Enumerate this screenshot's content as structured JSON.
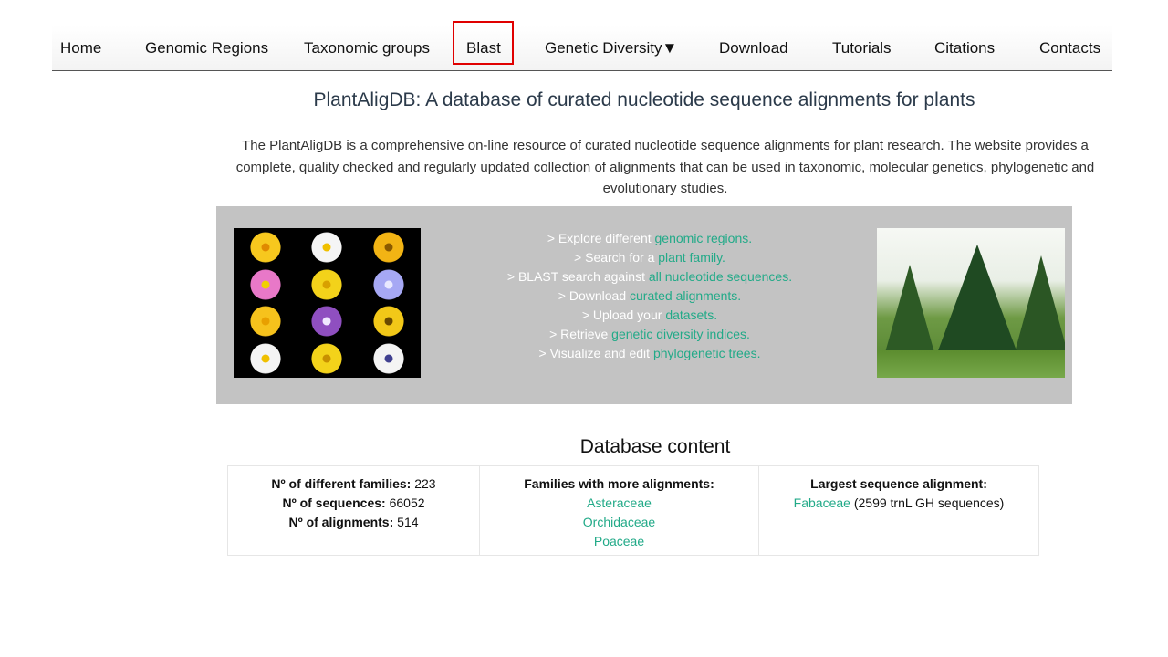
{
  "nav": {
    "items": [
      {
        "label": "Home"
      },
      {
        "label": "Genomic Regions"
      },
      {
        "label": "Taxonomic groups"
      },
      {
        "label": "Blast"
      },
      {
        "label": "Genetic Diversity▼"
      },
      {
        "label": "Download"
      },
      {
        "label": "Tutorials"
      },
      {
        "label": "Citations"
      },
      {
        "label": "Contacts"
      }
    ]
  },
  "page": {
    "title": "PlantAligDB: A database of curated nucleotide sequence alignments for plants",
    "intro": "The PlantAligDB is a comprehensive on-line resource of curated nucleotide sequence alignments for plant research. The website provides a complete, quality checked and regularly updated collection of alignments that can be used in taxonomic, molecular genetics, phylogenetic and evolutionary studies."
  },
  "hero": {
    "lines": [
      {
        "prefix": "> Explore different ",
        "link": "genomic regions."
      },
      {
        "prefix": "> Search for a ",
        "link": "plant family."
      },
      {
        "prefix": "> BLAST search against ",
        "link": "all nucleotide sequences."
      },
      {
        "prefix": "> Download ",
        "link": "curated alignments."
      },
      {
        "prefix": "> Upload your ",
        "link": "datasets."
      },
      {
        "prefix": "> Retrieve ",
        "link": "genetic diversity indices."
      },
      {
        "prefix": "> Visualize and edit ",
        "link": "phylogenetic trees."
      }
    ]
  },
  "db": {
    "title": "Database content",
    "families_label": "Nº of different families:",
    "families_value": "223",
    "sequences_label": "Nº of sequences:",
    "sequences_value": "66052",
    "alignments_label": "Nº of alignments:",
    "alignments_value": "514",
    "more_label": "Families with more alignments:",
    "more_families": [
      "Asteraceae",
      "Orchidaceae",
      "Poaceae"
    ],
    "largest_label": "Largest sequence alignment:",
    "largest_family": "Fabaceae",
    "largest_detail": "(2599 trnL GH sequences)"
  },
  "colors": {
    "link": "#22aa88",
    "hero_bg": "#c3c3c3",
    "highlight": "#e00000"
  }
}
